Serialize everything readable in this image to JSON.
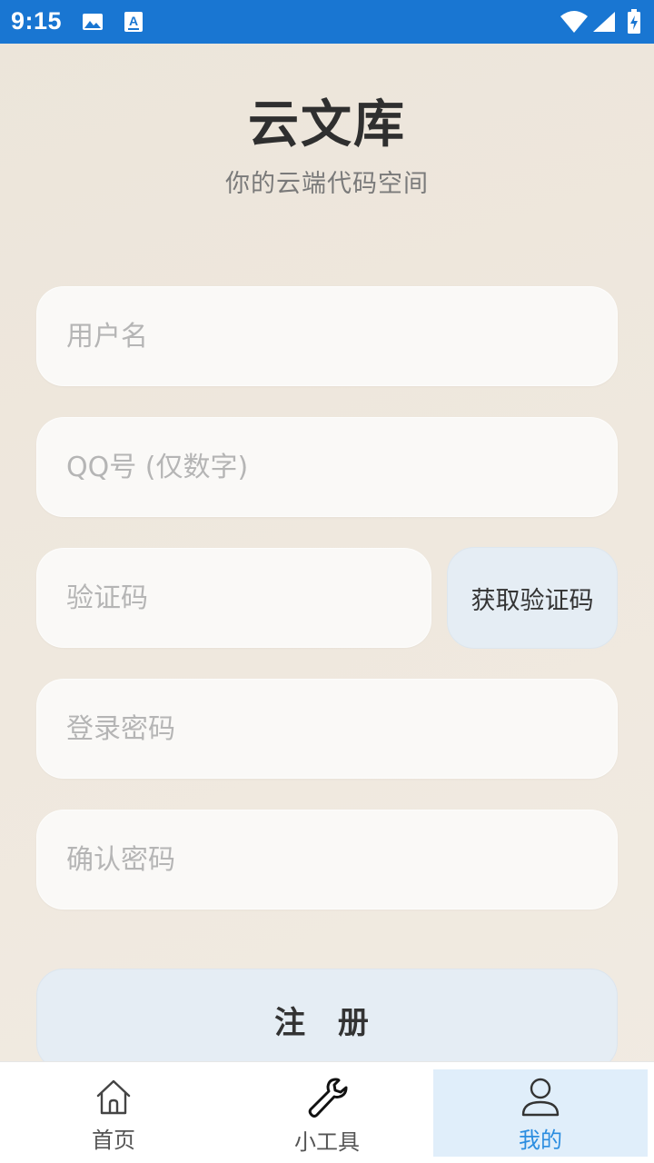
{
  "status_bar": {
    "time": "9:15",
    "icons": [
      "image-icon",
      "text-a-icon",
      "wifi-icon",
      "signal-icon",
      "battery-charging-icon"
    ]
  },
  "header": {
    "title": "云文库",
    "subtitle": "你的云端代码空间"
  },
  "form": {
    "username_placeholder": "用户名",
    "qq_placeholder": "QQ号 (仅数字)",
    "code_placeholder": "验证码",
    "get_code_label": "获取验证码",
    "password_placeholder": "登录密码",
    "confirm_placeholder": "确认密码",
    "register_label": "注 册"
  },
  "bottom_nav": {
    "items": [
      {
        "label": "首页",
        "icon": "home-icon"
      },
      {
        "label": "小工具",
        "icon": "wrench-icon"
      },
      {
        "label": "我的",
        "icon": "user-icon",
        "active": true
      }
    ]
  },
  "colors": {
    "status_bar": "#1976d2",
    "accent": "#2b8de0",
    "button_bg": "#e5edf4",
    "active_tab_bg": "#e0eefa"
  }
}
